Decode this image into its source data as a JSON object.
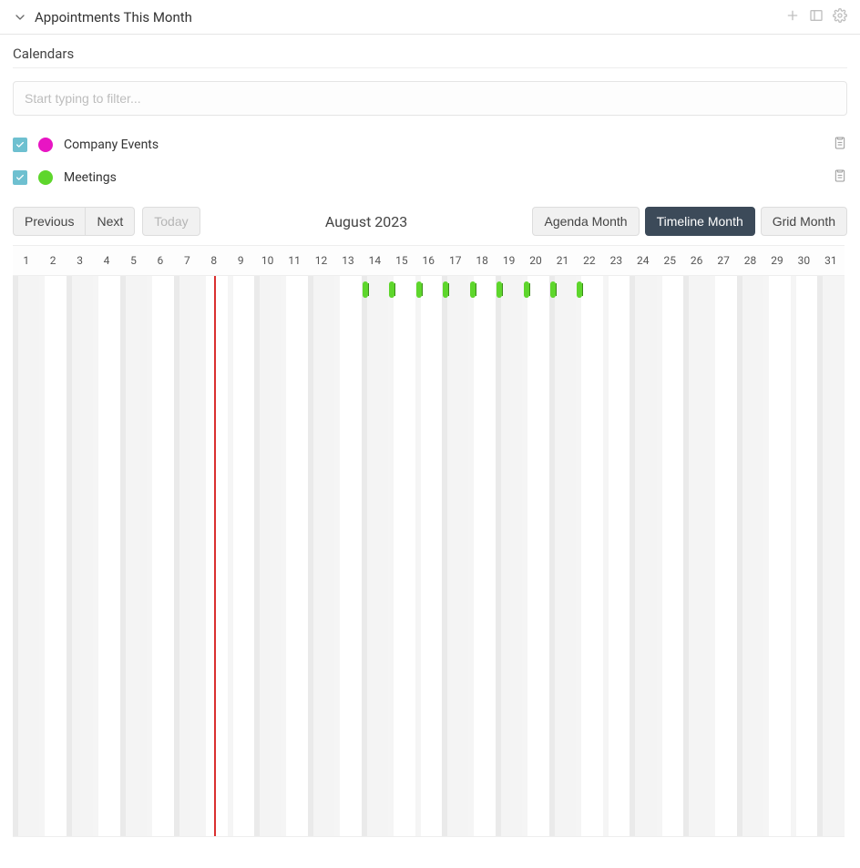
{
  "header": {
    "title": "Appointments This Month"
  },
  "calendars_section": {
    "title": "Calendars",
    "filter_placeholder": "Start typing to filter..."
  },
  "calendars": [
    {
      "label": "Company Events",
      "color": "#e815c3",
      "checked": true
    },
    {
      "label": "Meetings",
      "color": "#5ed62c",
      "checked": true
    }
  ],
  "toolbar": {
    "previous": "Previous",
    "next": "Next",
    "today": "Today",
    "month_label": "August 2023",
    "views": [
      {
        "label": "Agenda Month",
        "active": false
      },
      {
        "label": "Timeline Month",
        "active": true
      },
      {
        "label": "Grid Month",
        "active": false
      }
    ]
  },
  "timeline": {
    "days": [
      "1",
      "2",
      "3",
      "4",
      "5",
      "6",
      "7",
      "8",
      "9",
      "10",
      "11",
      "12",
      "13",
      "14",
      "15",
      "16",
      "17",
      "18",
      "19",
      "20",
      "21",
      "22",
      "23",
      "24",
      "25",
      "26",
      "27",
      "28",
      "29",
      "30",
      "31"
    ],
    "shaded_days": [
      1,
      3,
      5,
      7,
      10,
      12,
      14,
      17,
      19,
      21,
      24,
      26,
      28,
      31
    ],
    "current_day_index": 7,
    "current_fraction": 0.5,
    "events": [
      {
        "day_index": 13,
        "calendar": 1
      },
      {
        "day_index": 14,
        "calendar": 1
      },
      {
        "day_index": 15,
        "calendar": 1
      },
      {
        "day_index": 16,
        "calendar": 1
      },
      {
        "day_index": 17,
        "calendar": 1
      },
      {
        "day_index": 18,
        "calendar": 1
      },
      {
        "day_index": 19,
        "calendar": 1
      },
      {
        "day_index": 20,
        "calendar": 1
      },
      {
        "day_index": 21,
        "calendar": 1
      }
    ]
  },
  "colors": {
    "accent_checkbox": "#6ec0d0",
    "active_view_bg": "#3c4a59",
    "current_marker": "#d93030"
  }
}
